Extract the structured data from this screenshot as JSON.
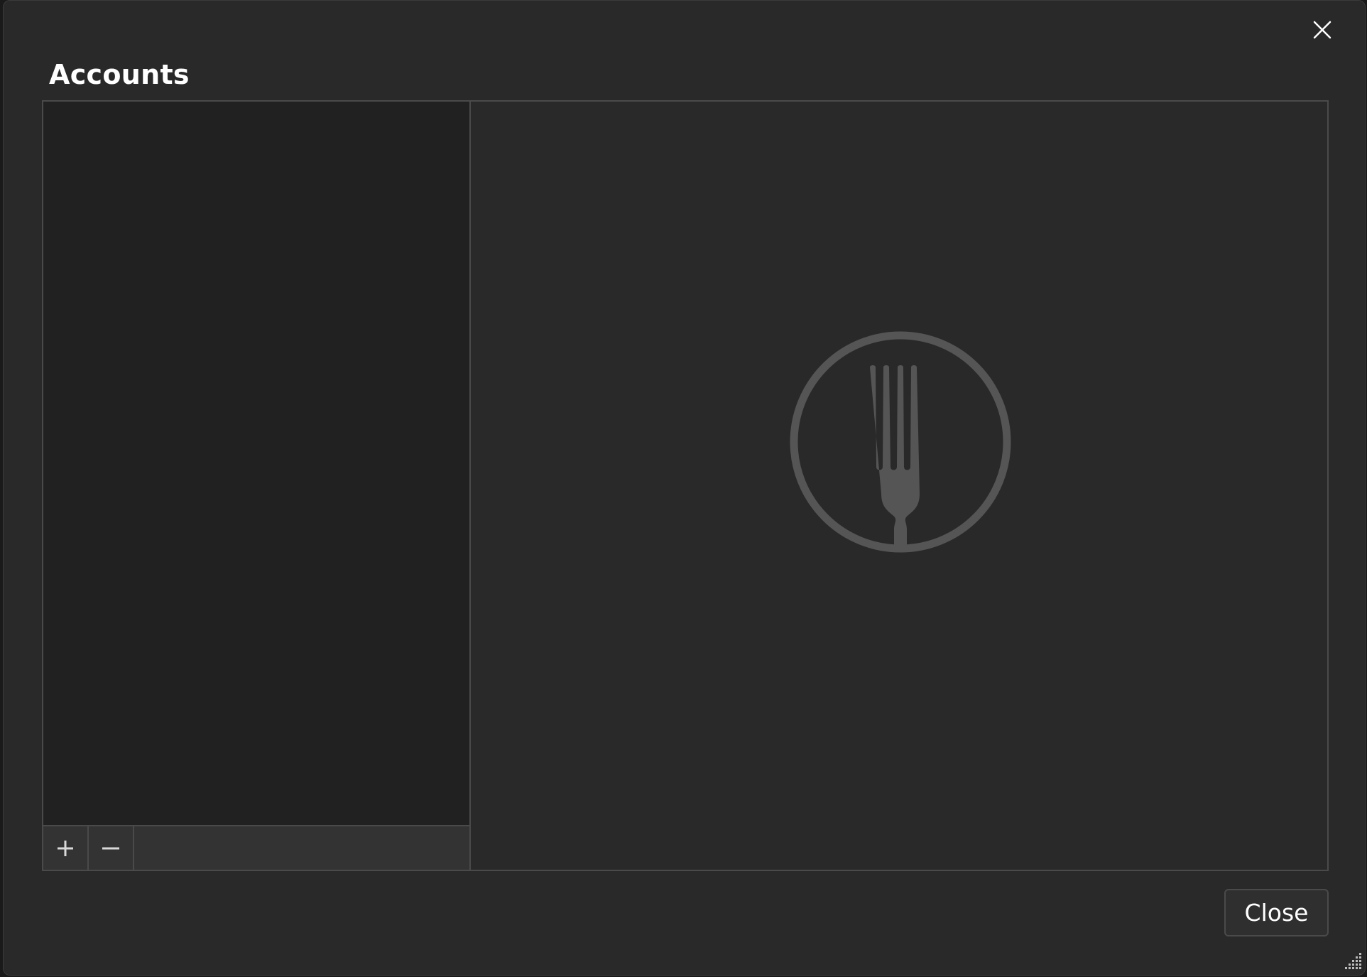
{
  "dialog": {
    "title": "Accounts",
    "close_button_label": "Close"
  },
  "toolbar": {
    "add_button_icon": "plus-icon",
    "remove_button_icon": "minus-icon"
  },
  "accounts": [],
  "placeholder": {
    "icon": "fork-logo-icon"
  },
  "colors": {
    "window_bg": "#292929",
    "list_bg": "#212121",
    "border": "#4a4a4a",
    "logo": "#555555",
    "text": "#ffffff"
  }
}
